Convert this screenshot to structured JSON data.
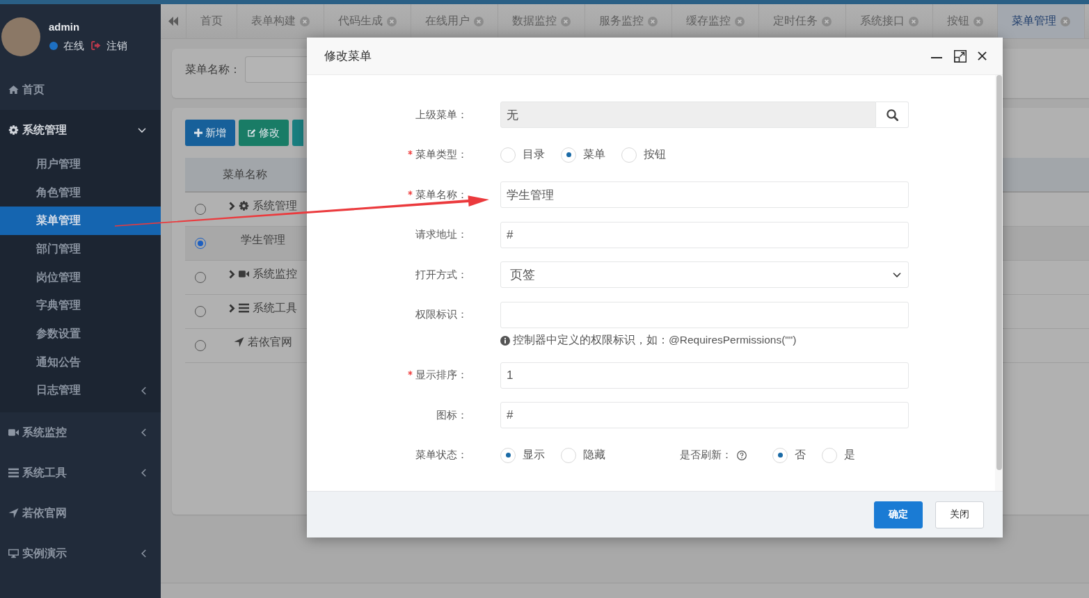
{
  "sidebar": {
    "user": {
      "name": "admin",
      "status": "在线",
      "logout": "注销"
    },
    "items": [
      {
        "label": "首页",
        "kind": "link",
        "selected": false
      },
      {
        "label": "系统管理",
        "kind": "group",
        "expanded": true,
        "selected": false,
        "children": [
          {
            "label": "用户管理",
            "kind": "link",
            "selected": false
          },
          {
            "label": "角色管理",
            "kind": "link",
            "selected": false
          },
          {
            "label": "菜单管理",
            "kind": "link",
            "selected": true
          },
          {
            "label": "部门管理",
            "kind": "link",
            "selected": false
          },
          {
            "label": "岗位管理",
            "kind": "link",
            "selected": false
          },
          {
            "label": "字典管理",
            "kind": "link",
            "selected": false
          },
          {
            "label": "参数设置",
            "kind": "link",
            "selected": false
          },
          {
            "label": "通知公告",
            "kind": "link",
            "selected": false
          },
          {
            "label": "日志管理",
            "kind": "group",
            "expanded": false,
            "selected": false
          }
        ]
      },
      {
        "label": "系统监控",
        "kind": "group",
        "expanded": false,
        "selected": false
      },
      {
        "label": "系统工具",
        "kind": "group",
        "expanded": false,
        "selected": false
      },
      {
        "label": "若依官网",
        "kind": "link",
        "selected": false
      },
      {
        "label": "实例演示",
        "kind": "group",
        "expanded": false,
        "selected": false
      }
    ]
  },
  "tabs": [
    {
      "label": "首页",
      "closable": false,
      "selected": false
    },
    {
      "label": "表单构建",
      "closable": true,
      "selected": false
    },
    {
      "label": "代码生成",
      "closable": true,
      "selected": false
    },
    {
      "label": "在线用户",
      "closable": true,
      "selected": false
    },
    {
      "label": "数据监控",
      "closable": true,
      "selected": false
    },
    {
      "label": "服务监控",
      "closable": true,
      "selected": false
    },
    {
      "label": "缓存监控",
      "closable": true,
      "selected": false
    },
    {
      "label": "定时任务",
      "closable": true,
      "selected": false
    },
    {
      "label": "系统接口",
      "closable": true,
      "selected": false
    },
    {
      "label": "按钮",
      "closable": true,
      "selected": false
    },
    {
      "label": "菜单管理",
      "closable": true,
      "selected": true
    }
  ],
  "search": {
    "label": "菜单名称："
  },
  "toolbar": [
    {
      "label": "新增",
      "kind": "primary"
    },
    {
      "label": "修改",
      "kind": "success"
    },
    {
      "kind": "info"
    }
  ],
  "table": {
    "columns": [
      "菜单名称"
    ],
    "rows": [
      {
        "name": "系统管理",
        "kind": "folder",
        "expanded": false,
        "selected": false
      },
      {
        "name": "学生管理",
        "kind": "item",
        "selected": true
      },
      {
        "name": "系统监控",
        "kind": "folder",
        "expanded": false,
        "selected": false
      },
      {
        "name": "系统工具",
        "kind": "folder",
        "expanded": false,
        "selected": false
      },
      {
        "name": "若依官网",
        "kind": "item",
        "selected": false
      }
    ]
  },
  "dialog": {
    "title": "修改菜单",
    "rows": [
      {
        "kind": "lookup",
        "label": "上级菜单：",
        "required": false,
        "value": "无"
      },
      {
        "kind": "radio",
        "label": "菜单类型：",
        "required": true,
        "options": [
          {
            "label": "目录",
            "selected": false
          },
          {
            "label": "菜单",
            "selected": true
          },
          {
            "label": "按钮",
            "selected": false
          }
        ]
      },
      {
        "kind": "text",
        "label": "菜单名称：",
        "required": true,
        "value": "学生管理"
      },
      {
        "kind": "text",
        "label": "请求地址：",
        "required": false,
        "value": "#"
      },
      {
        "kind": "select",
        "label": "打开方式：",
        "required": false,
        "value": "页签"
      },
      {
        "kind": "text",
        "label": "权限标识：",
        "required": false,
        "help": "控制器中定义的权限标识，如：@RequiresPermissions(\"\")"
      },
      {
        "kind": "text",
        "label": "显示排序：",
        "required": true,
        "value": "1"
      },
      {
        "kind": "text",
        "label": "图标：",
        "required": false,
        "value": "#"
      },
      {
        "kind": "radio",
        "label": "菜单状态：",
        "required": false,
        "options": [
          {
            "label": "显示",
            "selected": true
          },
          {
            "label": "隐藏",
            "selected": false
          }
        ],
        "side": {
          "label": "是否刷新：",
          "options": [
            {
              "label": "否",
              "selected": true
            },
            {
              "label": "是",
              "selected": false
            }
          ]
        }
      }
    ],
    "buttons": [
      {
        "label": "确定",
        "kind": "primary"
      },
      {
        "label": "关闭",
        "kind": "default"
      }
    ]
  }
}
